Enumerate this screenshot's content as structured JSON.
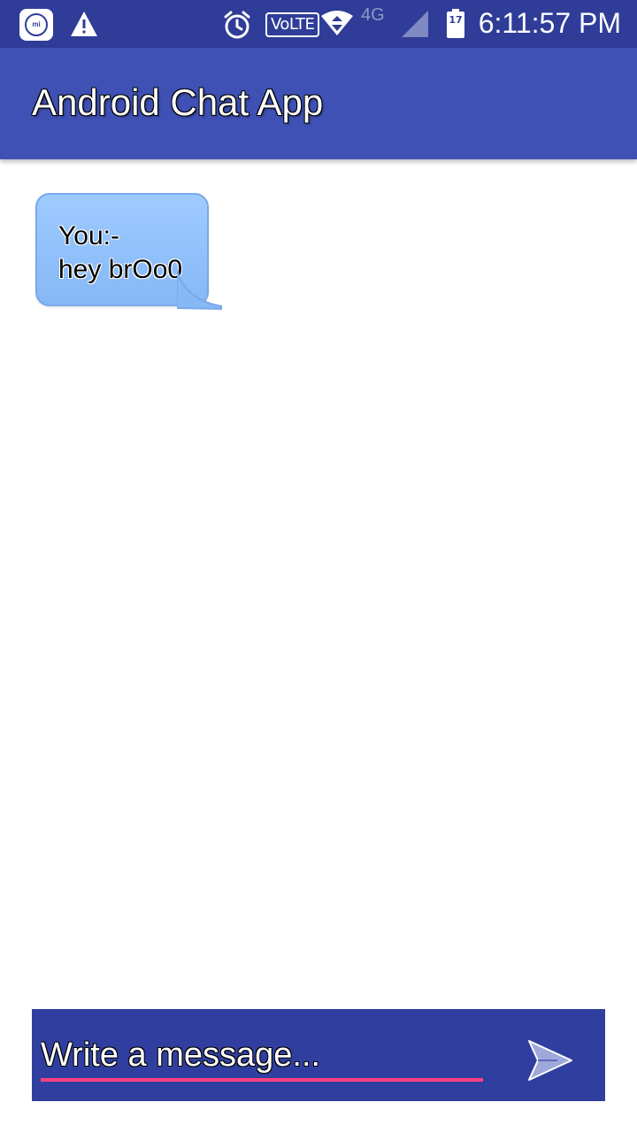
{
  "status_bar": {
    "network": "4G",
    "volte_label": "VoLTE",
    "battery_level": "17",
    "time": "6:11:57 PM",
    "icons": [
      "mi-icon",
      "warning-icon",
      "alarm-icon",
      "volte-icon",
      "wifi-icon",
      "signal-icon",
      "battery-icon"
    ]
  },
  "app_bar": {
    "title": "Android Chat App",
    "color": "#3f51b5"
  },
  "messages": [
    {
      "sender": "You:-",
      "text": "hey brOo0"
    }
  ],
  "composer": {
    "placeholder": "Write a message...",
    "value": "",
    "send_icon": "send-icon",
    "background": "#303f9f",
    "underline_color": "#ff4081"
  }
}
